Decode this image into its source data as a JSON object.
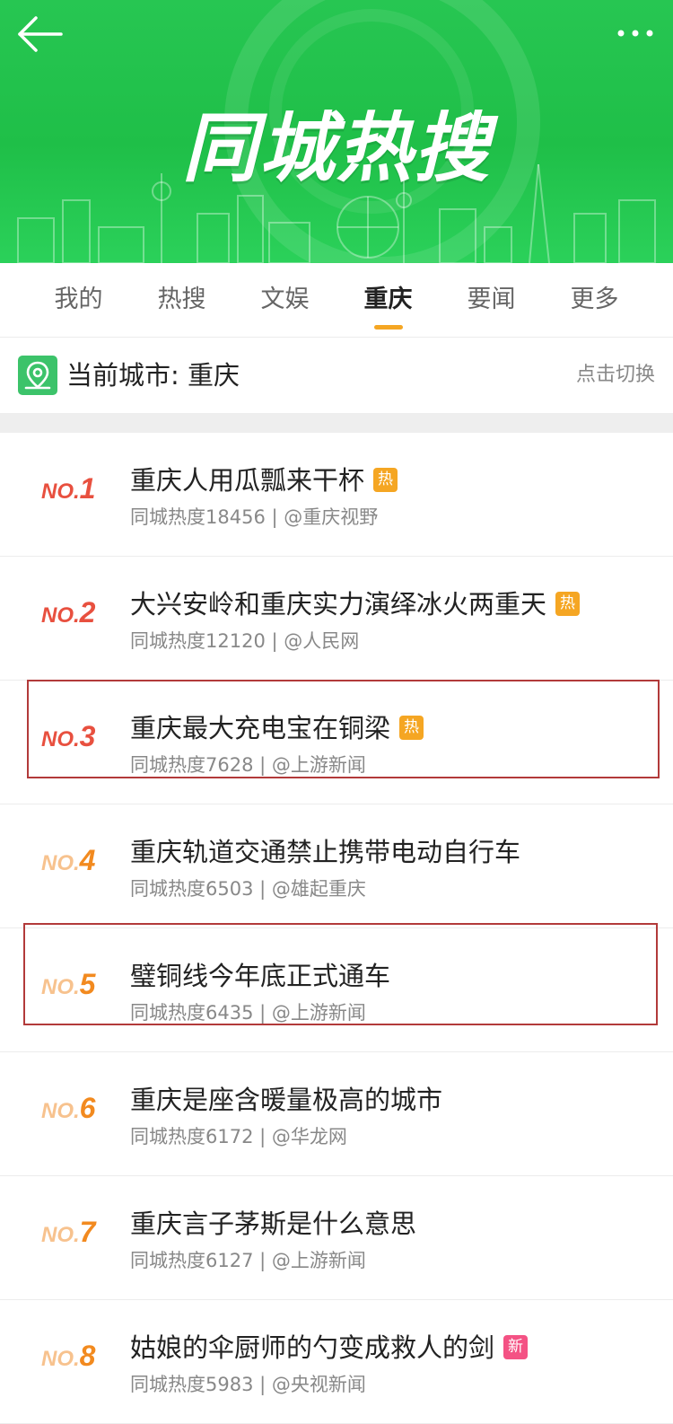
{
  "header": {
    "title": "同城热搜",
    "back_icon": "arrow-left-icon",
    "more_icon": "more-dots-icon"
  },
  "tabs": [
    {
      "label": "我的"
    },
    {
      "label": "热搜"
    },
    {
      "label": "文娱"
    },
    {
      "label": "重庆",
      "active": true
    },
    {
      "label": "要闻"
    },
    {
      "label": "更多"
    }
  ],
  "city": {
    "label": "当前城市: 重庆",
    "switch_label": "点击切换",
    "icon": "map-pin-icon"
  },
  "colors": {
    "brand_green": "#27c652",
    "accent_orange": "#f5a623",
    "rank_red": "#e8503f",
    "rank_orange": "#f28a1f",
    "badge_hot": "#f5a623",
    "badge_new": "#f45284",
    "highlight_border": "#b23a3a"
  },
  "items": [
    {
      "no": "NO.",
      "rank": "1",
      "title": "重庆人用瓜瓢来干杯",
      "badge": "热",
      "badge_type": "hot",
      "meta": "同城热度18456 | @重庆视野"
    },
    {
      "no": "NO.",
      "rank": "2",
      "title": "大兴安岭和重庆实力演绎冰火两重天",
      "badge": "热",
      "badge_type": "hot",
      "meta": "同城热度12120 | @人民网"
    },
    {
      "no": "NO.",
      "rank": "3",
      "title": "重庆最大充电宝在铜梁",
      "badge": "热",
      "badge_type": "hot",
      "meta": "同城热度7628 | @上游新闻",
      "highlighted": true
    },
    {
      "no": "NO.",
      "rank": "4",
      "title": "重庆轨道交通禁止携带电动自行车",
      "badge": "",
      "meta": "同城热度6503 | @雄起重庆"
    },
    {
      "no": "NO.",
      "rank": "5",
      "title": "璧铜线今年底正式通车",
      "badge": "",
      "meta": "同城热度6435 | @上游新闻",
      "highlighted": true
    },
    {
      "no": "NO.",
      "rank": "6",
      "title": "重庆是座含暖量极高的城市",
      "badge": "",
      "meta": "同城热度6172 | @华龙网"
    },
    {
      "no": "NO.",
      "rank": "7",
      "title": "重庆言子茅斯是什么意思",
      "badge": "",
      "meta": "同城热度6127 | @上游新闻"
    },
    {
      "no": "NO.",
      "rank": "8",
      "title": "姑娘的伞厨师的勺变成救人的剑",
      "badge": "新",
      "badge_type": "new",
      "meta": "同城热度5983 | @央视新闻"
    }
  ]
}
